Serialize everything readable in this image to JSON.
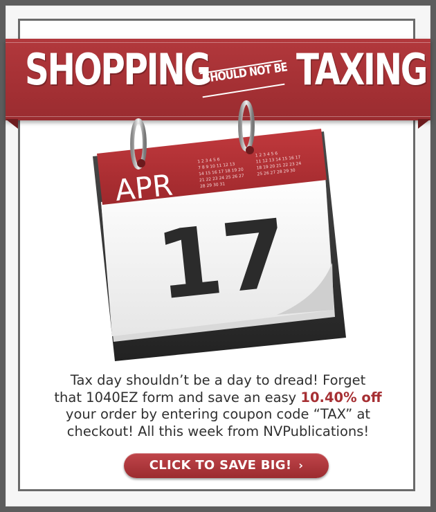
{
  "banner": {
    "word_left": "SHOPPING",
    "word_small": "SHOULD NOT BE",
    "word_right": "TAXING"
  },
  "calendar": {
    "month": "APR",
    "day": "17",
    "mini_month_left": [
      "1 2 3 4 5 6",
      "7 8 9 10 11 12 13",
      "14 15 16 17 18 19 20",
      "21 22 23 24 25 26 27",
      "28 29 30 31"
    ],
    "mini_month_right": [
      "1 2 3 4 5 6",
      "11 12 13 14 15 16 17",
      "18 19 20 21 22 23 24",
      "25 26 27 28 29 30"
    ]
  },
  "body": {
    "line1": "Tax day shouldn’t be a day to dread! Forget",
    "line2_a": "that 1040EZ form and save an easy ",
    "line2_bold": "10.40% off",
    "line3": "your order by entering coupon code “TAX” at",
    "line4": "checkout! All this week from NVPublications!"
  },
  "cta": {
    "label": "CLICK TO SAVE BIG!",
    "arrow": "›"
  },
  "colors": {
    "brand_red": "#a43034",
    "background": "#5d5d5d"
  }
}
